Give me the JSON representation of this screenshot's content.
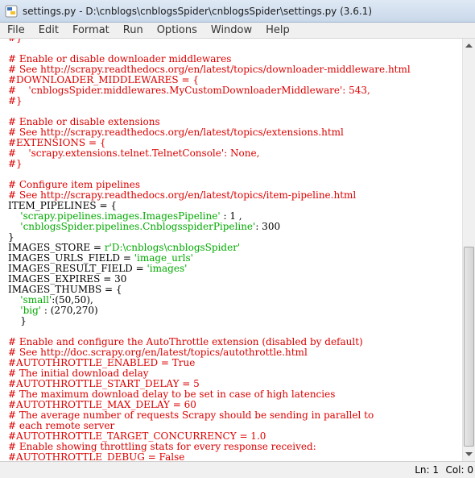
{
  "window": {
    "title": "settings.py - D:\\cnblogs\\cnblogsSpider\\cnblogsSpider\\settings.py (3.6.1)"
  },
  "menu": [
    "File",
    "Edit",
    "Format",
    "Run",
    "Options",
    "Window",
    "Help"
  ],
  "editor": {
    "lines": [
      [
        [
          "c",
          "#}"
        ]
      ],
      [
        [
          "n",
          ""
        ]
      ],
      [
        [
          "c",
          "# Enable or disable downloader middlewares"
        ]
      ],
      [
        [
          "c",
          "# See http://scrapy.readthedocs.org/en/latest/topics/downloader-middleware.html"
        ]
      ],
      [
        [
          "c",
          "#DOWNLOADER_MIDDLEWARES = {"
        ]
      ],
      [
        [
          "c",
          "#    'cnblogsSpider.middlewares.MyCustomDownloaderMiddleware': 543,"
        ]
      ],
      [
        [
          "c",
          "#}"
        ]
      ],
      [
        [
          "n",
          ""
        ]
      ],
      [
        [
          "c",
          "# Enable or disable extensions"
        ]
      ],
      [
        [
          "c",
          "# See http://scrapy.readthedocs.org/en/latest/topics/extensions.html"
        ]
      ],
      [
        [
          "c",
          "#EXTENSIONS = {"
        ]
      ],
      [
        [
          "c",
          "#    'scrapy.extensions.telnet.TelnetConsole': None,"
        ]
      ],
      [
        [
          "c",
          "#}"
        ]
      ],
      [
        [
          "n",
          ""
        ]
      ],
      [
        [
          "c",
          "# Configure item pipelines"
        ]
      ],
      [
        [
          "c",
          "# See http://scrapy.readthedocs.org/en/latest/topics/item-pipeline.html"
        ]
      ],
      [
        [
          "n",
          "ITEM_PIPELINES = {"
        ]
      ],
      [
        [
          "n",
          "    "
        ],
        [
          "s",
          "'scrapy.pipelines.images.ImagesPipeline'"
        ],
        [
          "n",
          " : 1 ,"
        ]
      ],
      [
        [
          "n",
          "    "
        ],
        [
          "s",
          "'cnblogsSpider.pipelines.CnblogsspiderPipeline'"
        ],
        [
          "n",
          ": 300"
        ]
      ],
      [
        [
          "n",
          "}"
        ]
      ],
      [
        [
          "n",
          "IMAGES_STORE = "
        ],
        [
          "s",
          "r'D:\\cnblogs\\cnblogsSpider'"
        ]
      ],
      [
        [
          "n",
          "IMAGES_URLS_FIELD = "
        ],
        [
          "s",
          "'image_urls'"
        ]
      ],
      [
        [
          "n",
          "IMAGES_RESULT_FIELD = "
        ],
        [
          "s",
          "'images'"
        ]
      ],
      [
        [
          "n",
          "IMAGES_EXPIRES = 30"
        ]
      ],
      [
        [
          "n",
          "IMAGES_THUMBS = {"
        ]
      ],
      [
        [
          "n",
          "    "
        ],
        [
          "s",
          "'small'"
        ],
        [
          "n",
          ":(50,50),"
        ]
      ],
      [
        [
          "n",
          "    "
        ],
        [
          "s",
          "'big'"
        ],
        [
          "n",
          " : (270,270)"
        ]
      ],
      [
        [
          "n",
          "    }"
        ]
      ],
      [
        [
          "n",
          ""
        ]
      ],
      [
        [
          "c",
          "# Enable and configure the AutoThrottle extension (disabled by default)"
        ]
      ],
      [
        [
          "c",
          "# See http://doc.scrapy.org/en/latest/topics/autothrottle.html"
        ]
      ],
      [
        [
          "c",
          "#AUTOTHROTTLE_ENABLED = True"
        ]
      ],
      [
        [
          "c",
          "# The initial download delay"
        ]
      ],
      [
        [
          "c",
          "#AUTOTHROTTLE_START_DELAY = 5"
        ]
      ],
      [
        [
          "c",
          "# The maximum download delay to be set in case of high latencies"
        ]
      ],
      [
        [
          "c",
          "#AUTOTHROTTLE_MAX_DELAY = 60"
        ]
      ],
      [
        [
          "c",
          "# The average number of requests Scrapy should be sending in parallel to"
        ]
      ],
      [
        [
          "c",
          "# each remote server"
        ]
      ],
      [
        [
          "c",
          "#AUTOTHROTTLE_TARGET_CONCURRENCY = 1.0"
        ]
      ],
      [
        [
          "c",
          "# Enable showing throttling stats for every response received:"
        ]
      ],
      [
        [
          "c",
          "#AUTOTHROTTLE_DEBUG = False"
        ]
      ]
    ]
  },
  "status": {
    "line": "Ln: 1",
    "col": "Col: 0"
  },
  "colors": {
    "comment": "#dd0000",
    "string": "#00aa00",
    "default": "#000000"
  }
}
